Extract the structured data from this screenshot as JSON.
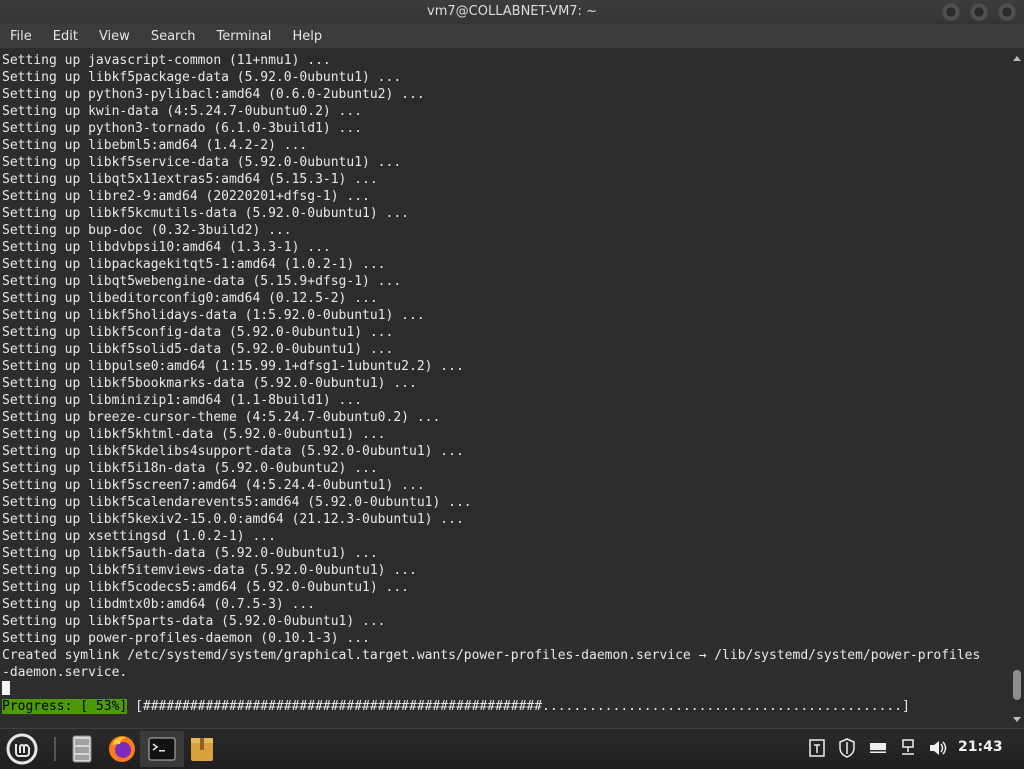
{
  "window": {
    "title": "vm7@COLLABNET-VM7: ~"
  },
  "menu": [
    "File",
    "Edit",
    "View",
    "Search",
    "Terminal",
    "Help"
  ],
  "terminal": {
    "lines": [
      "Setting up javascript-common (11+nmu1) ...",
      "Setting up libkf5package-data (5.92.0-0ubuntu1) ...",
      "Setting up python3-pylibacl:amd64 (0.6.0-2ubuntu2) ...",
      "Setting up kwin-data (4:5.24.7-0ubuntu0.2) ...",
      "Setting up python3-tornado (6.1.0-3build1) ...",
      "Setting up libebml5:amd64 (1.4.2-2) ...",
      "Setting up libkf5service-data (5.92.0-0ubuntu1) ...",
      "Setting up libqt5x11extras5:amd64 (5.15.3-1) ...",
      "Setting up libre2-9:amd64 (20220201+dfsg-1) ...",
      "Setting up libkf5kcmutils-data (5.92.0-0ubuntu1) ...",
      "Setting up bup-doc (0.32-3build2) ...",
      "Setting up libdvbpsi10:amd64 (1.3.3-1) ...",
      "Setting up libpackagekitqt5-1:amd64 (1.0.2-1) ...",
      "Setting up libqt5webengine-data (5.15.9+dfsg-1) ...",
      "Setting up libeditorconfig0:amd64 (0.12.5-2) ...",
      "Setting up libkf5holidays-data (1:5.92.0-0ubuntu1) ...",
      "Setting up libkf5config-data (5.92.0-0ubuntu1) ...",
      "Setting up libkf5solid5-data (5.92.0-0ubuntu1) ...",
      "Setting up libpulse0:amd64 (1:15.99.1+dfsg1-1ubuntu2.2) ...",
      "Setting up libkf5bookmarks-data (5.92.0-0ubuntu1) ...",
      "Setting up libminizip1:amd64 (1.1-8build1) ...",
      "Setting up breeze-cursor-theme (4:5.24.7-0ubuntu0.2) ...",
      "Setting up libkf5khtml-data (5.92.0-0ubuntu1) ...",
      "Setting up libkf5kdelibs4support-data (5.92.0-0ubuntu1) ...",
      "Setting up libkf5i18n-data (5.92.0-0ubuntu2) ...",
      "Setting up libkf5screen7:amd64 (4:5.24.4-0ubuntu1) ...",
      "Setting up libkf5calendarevents5:amd64 (5.92.0-0ubuntu1) ...",
      "Setting up libkf5kexiv2-15.0.0:amd64 (21.12.3-0ubuntu1) ...",
      "Setting up xsettingsd (1.0.2-1) ...",
      "Setting up libkf5auth-data (5.92.0-0ubuntu1) ...",
      "Setting up libkf5itemviews-data (5.92.0-0ubuntu1) ...",
      "Setting up libkf5codecs5:amd64 (5.92.0-0ubuntu1) ...",
      "Setting up libdmtx0b:amd64 (0.7.5-3) ...",
      "Setting up libkf5parts-data (5.92.0-0ubuntu1) ...",
      "Setting up power-profiles-daemon (0.10.1-3) ...",
      "Created symlink /etc/systemd/system/graphical.target.wants/power-profiles-daemon.service → /lib/systemd/system/power-profiles",
      "-daemon.service."
    ],
    "progress_label": "Progress: [ 53%]",
    "progress_bar": "[###################################################..............................................]",
    "progress_percent": 53
  },
  "taskbar": {
    "clock": "21:43",
    "apps": [
      "menu-icon",
      "files-icon",
      "firefox-icon",
      "terminal-icon",
      "archive-manager-icon"
    ],
    "tray": [
      "keyboard-layout-icon",
      "shield-icon",
      "display-icon",
      "network-icon",
      "volume-icon"
    ]
  }
}
